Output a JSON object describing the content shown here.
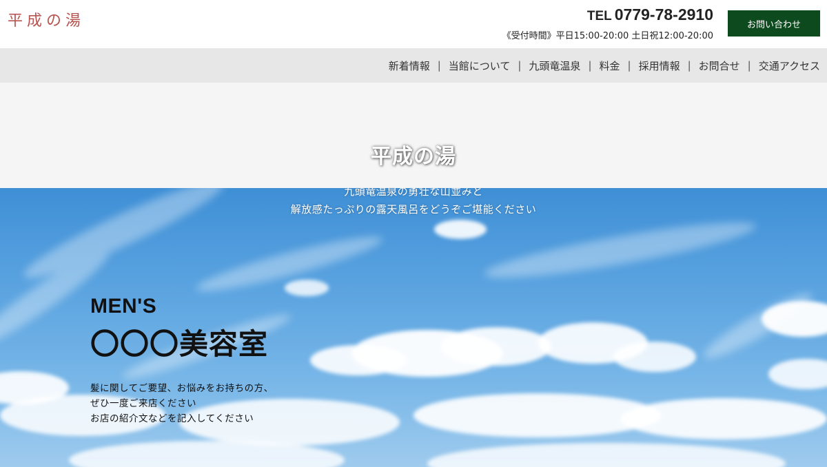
{
  "header": {
    "logo": "平成の湯",
    "tel_label": "TEL",
    "tel_number": "0779-78-2910",
    "hours": "《受付時間》平日15:00-20:00 土日祝12:00-20:00",
    "contact_label": "お問い合わせ"
  },
  "nav": {
    "items": [
      {
        "label": "新着情報"
      },
      {
        "label": "当館について"
      },
      {
        "label": "九頭竜温泉"
      },
      {
        "label": "料金"
      },
      {
        "label": "採用情報"
      },
      {
        "label": "お問合せ"
      },
      {
        "label": "交通アクセス"
      }
    ],
    "separator": "|"
  },
  "hero": {
    "title": "平成の湯",
    "subtitle_line1": "九頭竜温泉の勇壮な山並みと",
    "subtitle_line2": "解放感たっぷりの露天風呂をどうぞご堪能ください"
  },
  "feature": {
    "eyebrow": "MEN'S",
    "title": "〇〇〇美容室",
    "lines": [
      "髪に関してご要望、お悩みをお持ちの方、",
      "ぜひ一度ご来店ください",
      "お店の紹介文などを記入してください"
    ]
  },
  "colors": {
    "logo": "#b85450",
    "contact_button": "#0d4a1e",
    "nav_bg": "#e7e7e7",
    "band_bg": "#f5f5f5",
    "sky_top": "#3f8fd6",
    "sky_bottom": "#9fcbee"
  }
}
